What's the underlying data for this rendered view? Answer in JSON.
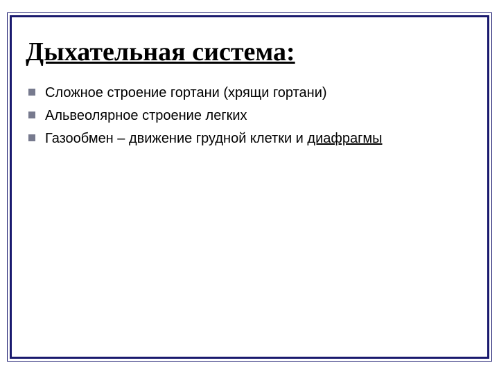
{
  "title": "Дыхательная система:",
  "bullets": [
    {
      "text": "Сложное строение гортани (хрящи гортани)"
    },
    {
      "text": "Альвеолярное строение легких"
    },
    {
      "text_prefix": "Газообмен – движение грудной клетки и ",
      "underlined": "диафрагмы"
    }
  ]
}
